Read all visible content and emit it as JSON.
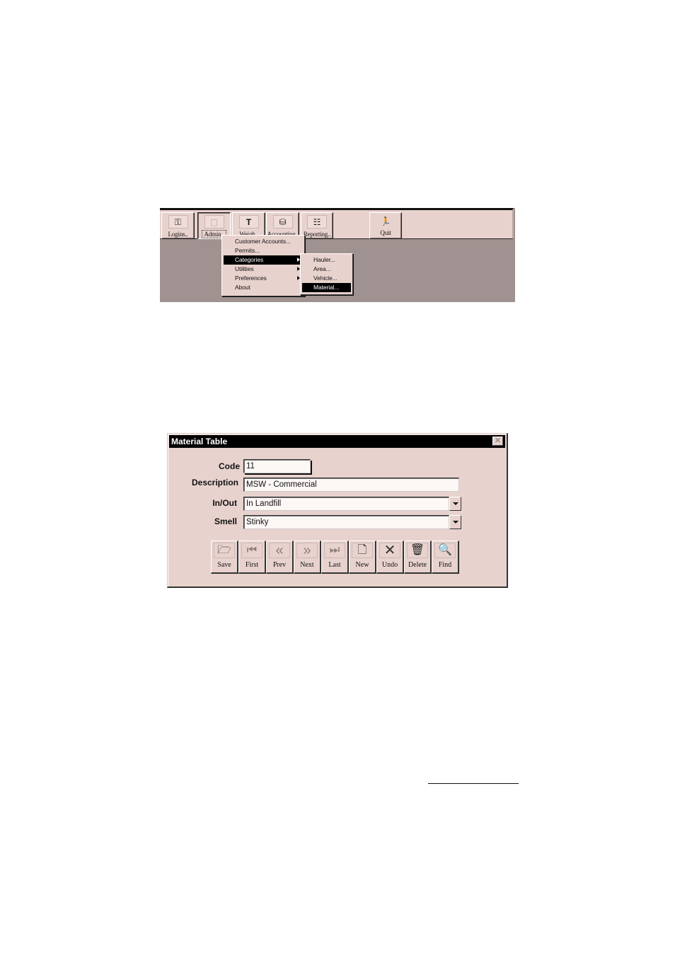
{
  "toolbar": {
    "buttons": [
      {
        "label": "Logins..",
        "icon": "key-icon"
      },
      {
        "label": "Admin..",
        "icon": "folder-icon",
        "pressed": true
      },
      {
        "label": "Weigh..",
        "icon": "scale-icon"
      },
      {
        "label": "Accounting..",
        "icon": "coins-icon"
      },
      {
        "label": "Reporting..",
        "icon": "report-icon"
      },
      {
        "label": "Quit",
        "icon": "exit-running-man-icon"
      }
    ]
  },
  "admin_menu": {
    "items": [
      {
        "label": "Customer Accounts...",
        "has_submenu": false
      },
      {
        "label": "Permits...",
        "has_submenu": false
      },
      {
        "label": "Categories",
        "has_submenu": true,
        "active": true
      },
      {
        "label": "Utilities",
        "has_submenu": true
      },
      {
        "label": "Preferences",
        "has_submenu": true
      },
      {
        "label": "About",
        "has_submenu": false
      }
    ],
    "categories_submenu": [
      {
        "label": "Hauler..."
      },
      {
        "label": "Area..."
      },
      {
        "label": "Vehicle..."
      },
      {
        "label": "Material...",
        "active": true
      }
    ]
  },
  "dialog": {
    "title": "Material Table",
    "close_glyph": "✕",
    "fields": {
      "code": {
        "label": "Code",
        "value": "11"
      },
      "description": {
        "label": "Description",
        "value": "MSW - Commercial"
      },
      "in_out": {
        "label": "In/Out",
        "value": "In Landfill"
      },
      "smell": {
        "label": "Smell",
        "value": "Stinky"
      }
    },
    "buttons": [
      {
        "label": "Save",
        "icon": "save-open-folder-icon",
        "glyph": "🗁",
        "enabled": true
      },
      {
        "label": "First",
        "icon": "first-record-icon",
        "glyph": "⏮",
        "enabled": false
      },
      {
        "label": "Prev",
        "icon": "previous-record-icon",
        "glyph": "«",
        "enabled": false
      },
      {
        "label": "Next",
        "icon": "next-record-icon",
        "glyph": "»",
        "enabled": false
      },
      {
        "label": "Last",
        "icon": "last-record-icon",
        "glyph": "⏭",
        "enabled": false
      },
      {
        "label": "New",
        "icon": "new-document-icon",
        "glyph": "🗋",
        "enabled": true
      },
      {
        "label": "Undo",
        "icon": "undo-x-icon",
        "glyph": "✕",
        "enabled": true
      },
      {
        "label": "Delete",
        "icon": "trash-icon",
        "glyph": "🗑",
        "enabled": true
      },
      {
        "label": "Find",
        "icon": "magnifier-icon",
        "glyph": "🔍",
        "enabled": true
      }
    ]
  },
  "colors": {
    "window_face": "#e8d2ce",
    "desktop": "#a09290",
    "title_bar": "#000000",
    "highlight": "#000000"
  }
}
